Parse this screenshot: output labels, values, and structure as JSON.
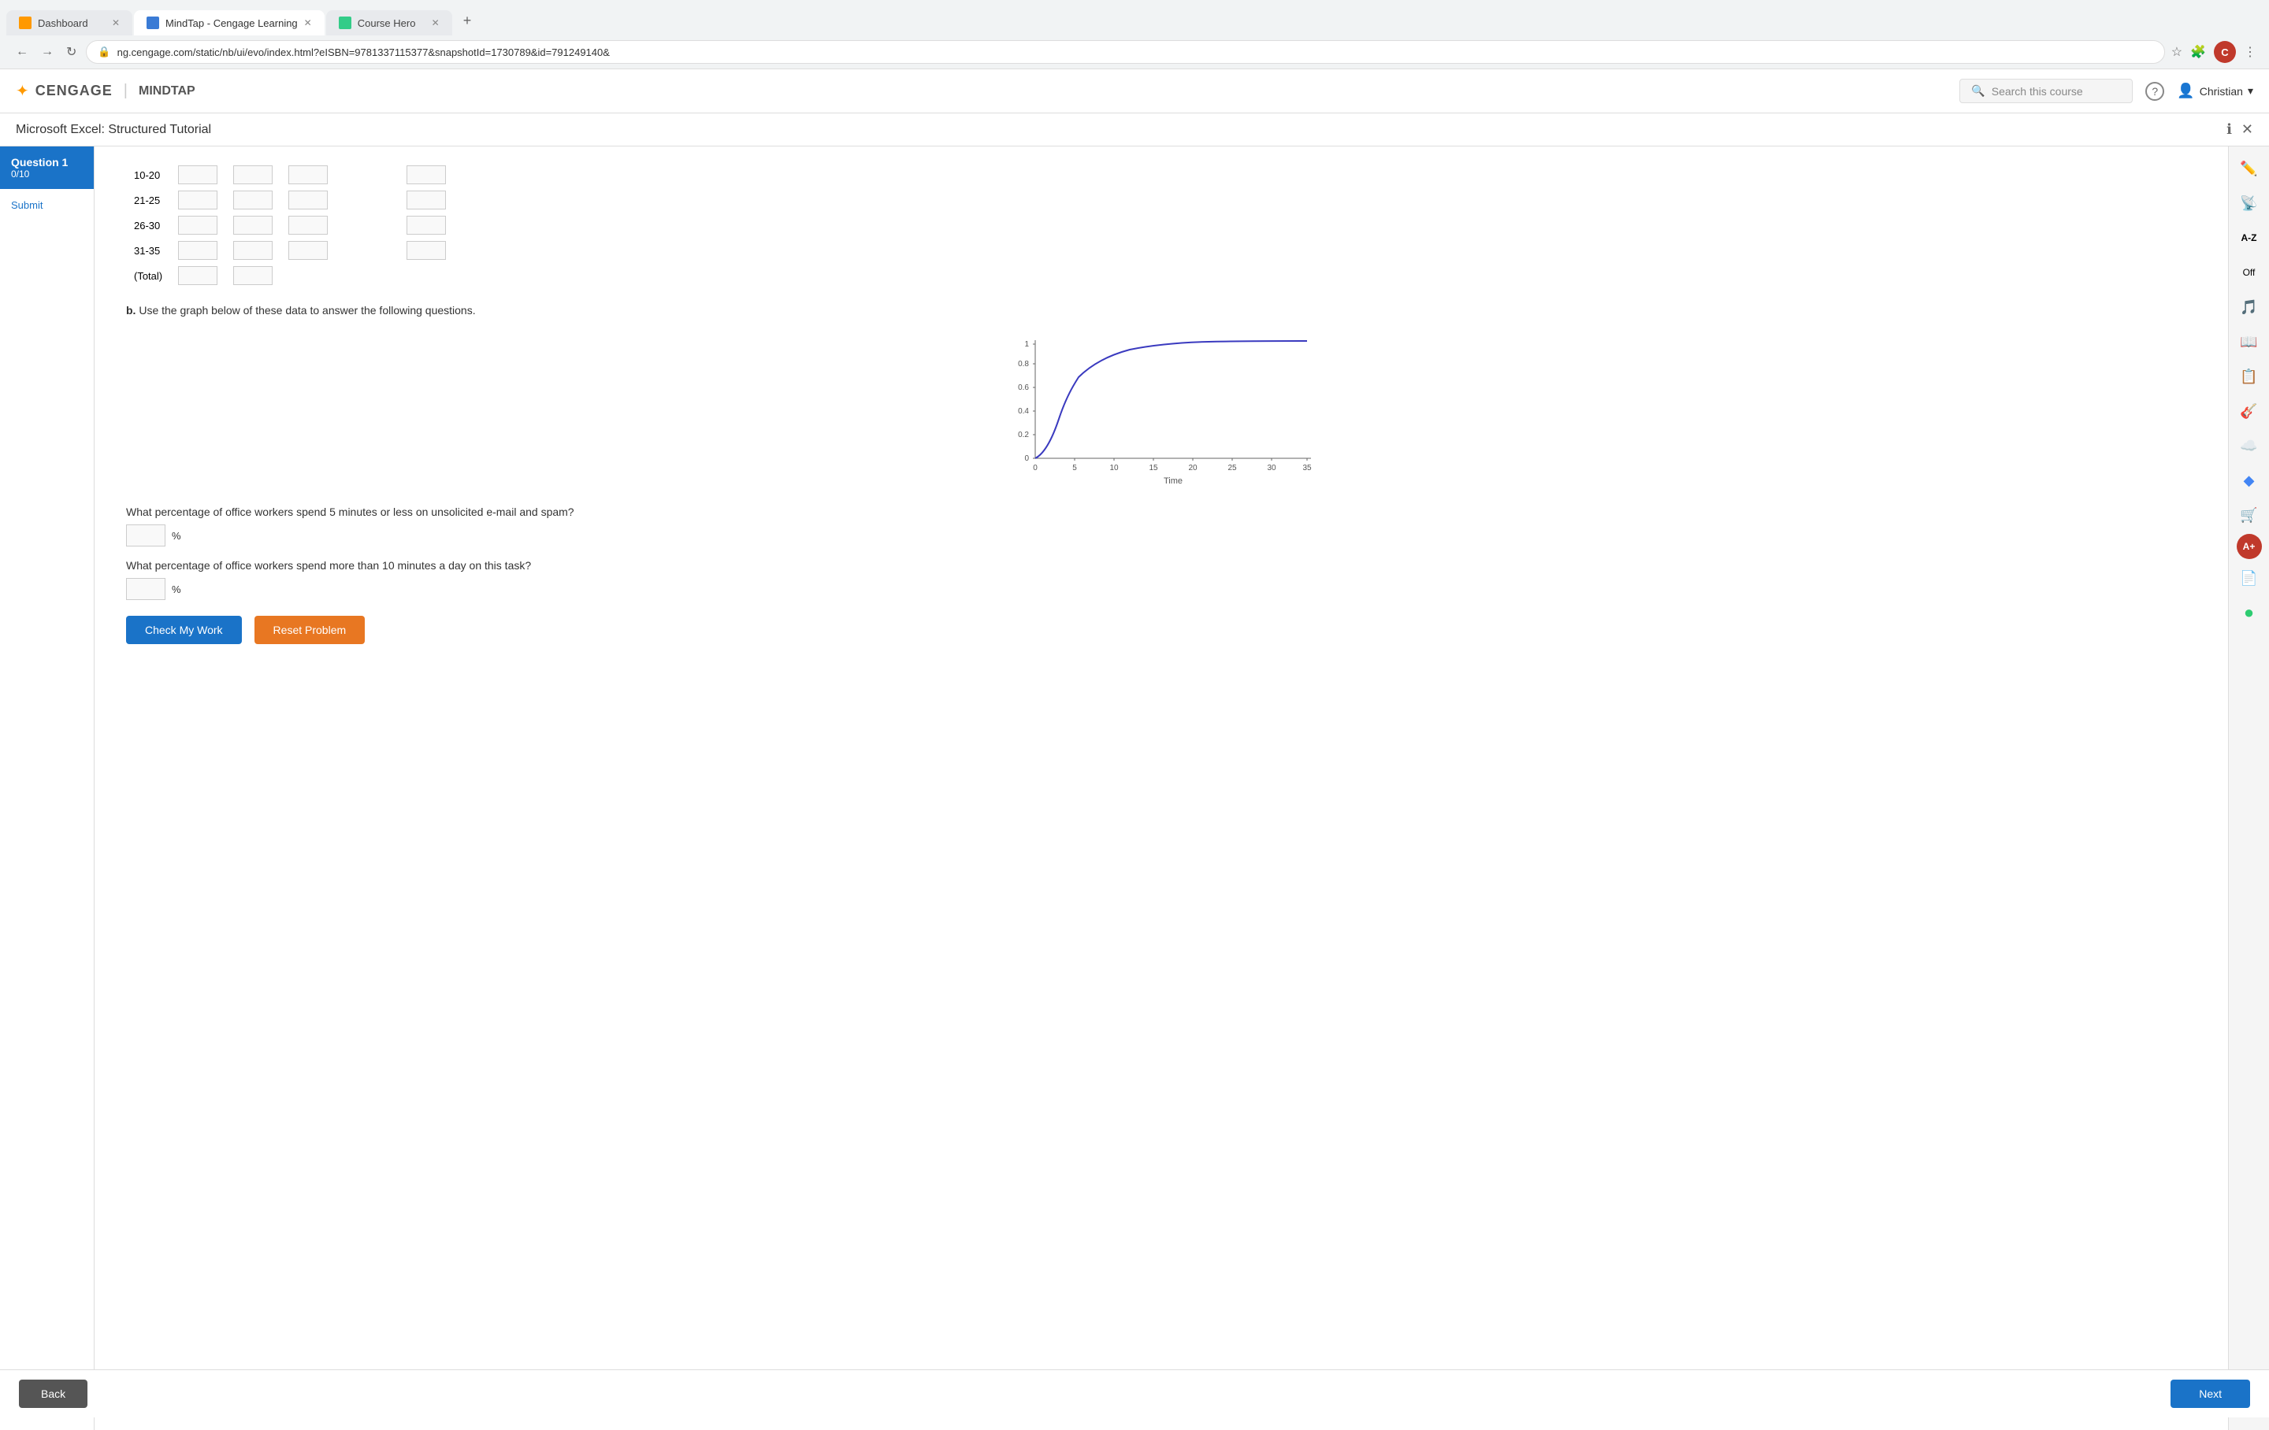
{
  "browser": {
    "tabs": [
      {
        "label": "Dashboard",
        "favicon_color": "#f90",
        "active": false
      },
      {
        "label": "MindTap - Cengage Learning",
        "favicon_color": "#3a7bd5",
        "active": true
      },
      {
        "label": "Course Hero",
        "favicon_color": "#3c8",
        "active": false
      }
    ],
    "url": "ng.cengage.com/static/nb/ui/evo/index.html?eISBN=9781337115377&snapshotId=1730789&id=791249140&"
  },
  "header": {
    "logo_icon": "★",
    "logo_text": "CENGAGE",
    "divider": "|",
    "mindtap_text": "MINDTAP",
    "search_placeholder": "Search this course",
    "help_icon": "?",
    "user_name": "Christian",
    "user_chevron": "▾",
    "user_initial": "C"
  },
  "page_title": "Microsoft Excel: Structured Tutorial",
  "sidebar": {
    "question_label": "Question 1",
    "question_score": "0/10",
    "submit_label": "Submit"
  },
  "table": {
    "row_10_20": "10-20",
    "row_21_25": "21-25",
    "row_26_30": "26-30",
    "row_31_35": "31-35",
    "row_total": "(Total)"
  },
  "instruction_b": "b.",
  "instruction_text": "Use the graph below of these data to answer the following questions.",
  "graph": {
    "x_label": "Time",
    "x_ticks": [
      "0",
      "5",
      "10",
      "15",
      "20",
      "25",
      "30",
      "35"
    ],
    "y_ticks": [
      "0",
      "0.2",
      "0.4",
      "0.6",
      "0.8",
      "1"
    ],
    "accent_color": "#3a3abf"
  },
  "question1_text": "What percentage of office workers spend 5 minutes or less on unsolicited e-mail and spam?",
  "question1_unit": "%",
  "question2_text": "What percentage of office workers spend more than 10 minutes a day on this task?",
  "question2_unit": "%",
  "buttons": {
    "check_label": "Check My Work",
    "reset_label": "Reset Problem"
  },
  "bottom": {
    "back_label": "Back",
    "next_label": "Next"
  },
  "right_icons": [
    "✏️",
    "📡",
    "A-Z",
    "⬜",
    "🎵",
    "📖",
    "📋",
    "🎸",
    "☁️",
    "◆",
    "🛒",
    "🅰",
    "📄",
    "⚫"
  ]
}
